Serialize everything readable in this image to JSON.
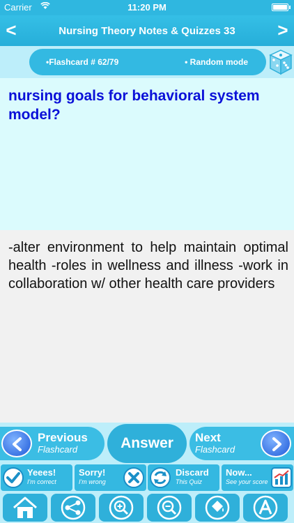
{
  "status_bar": {
    "carrier": "Carrier",
    "time": "11:20 PM"
  },
  "nav": {
    "prev_glyph": "<",
    "title": "Nursing Theory Notes & Quizzes 33",
    "next_glyph": ">"
  },
  "info": {
    "flashcard_label": "•Flashcard #  62/79",
    "mode_label": "• Random mode"
  },
  "card": {
    "question": "nursing goals for behavioral system model?",
    "answer": "-alter environment to help maintain optimal health -roles in wellness and illness -work in collaboration w/ other health care providers"
  },
  "controls": {
    "previous": {
      "line1": "Previous",
      "line2": "Flashcard"
    },
    "answer": "Answer",
    "next": {
      "line1": "Next",
      "line2": "Flashcard"
    }
  },
  "actions": {
    "correct": {
      "title": "Yeees!",
      "subtitle": "I'm correct"
    },
    "wrong": {
      "title": "Sorry!",
      "subtitle": "I'm wrong"
    },
    "discard": {
      "title": "Discard",
      "subtitle": "This Quiz"
    },
    "score": {
      "title": "Now...",
      "subtitle": "See your score"
    }
  },
  "toolbar": {
    "icons": [
      "home-icon",
      "share-icon",
      "zoom-in-icon",
      "zoom-out-icon",
      "paint-bucket-icon",
      "font-icon"
    ]
  },
  "colors": {
    "accent": "#2fb0da",
    "question_text": "#0a10d8",
    "light_band": "#bdeefa",
    "question_bg": "#dbfbfd",
    "answer_bg": "#f1f1f1"
  }
}
